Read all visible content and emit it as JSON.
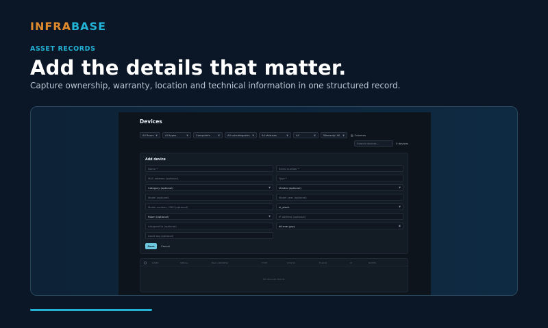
{
  "brand": {
    "part1": "INFRA",
    "part2": "BASE",
    "color1": "#e08a2e",
    "color2": "#22b3d6"
  },
  "eyebrow": "ASSET RECORDS",
  "headline": "Add the details that matter.",
  "subline": "Capture ownership, warranty, location and technical information in one structured record.",
  "progress": {
    "value": 0.25
  },
  "app": {
    "title": "Devices",
    "filters": [
      "All floors",
      "All types",
      "Computers",
      "All subcategories",
      "All statuses",
      "All",
      "Warranty: All"
    ],
    "columns_label": "Columns",
    "search_placeholder": "Search devices...",
    "count": "0 devices",
    "form": {
      "title": "Add device",
      "fields": {
        "name": "Name *",
        "serial": "Serial number *",
        "mac": "MAC address (optional)",
        "type": "Type *",
        "category": "Category (optional)",
        "vendor": "Vendor (optional)",
        "model": "Model (optional)",
        "model_year": "Model year (optional)",
        "model_number": "Model number / SKU (optional)",
        "status": "in_stock",
        "room": "Room (optional)",
        "ip": "IP address (optional)",
        "assigned": "Assigned to (optional)",
        "date": "dd.mm.yyyy",
        "asset_tag": "Asset tag (optional)"
      },
      "save_label": "Save",
      "cancel_label": "Cancel"
    },
    "table": {
      "headers": [
        "NAME",
        "SERIAL",
        "MAC ADDRESS",
        "TYPE",
        "STATUS",
        "FLOOR",
        "IP",
        "NOTES"
      ],
      "empty": "No devices found."
    }
  }
}
